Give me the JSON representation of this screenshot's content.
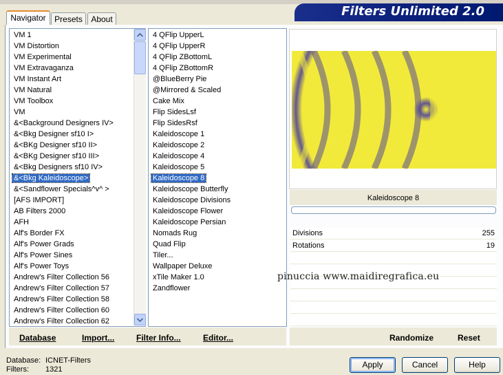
{
  "title": "Filters Unlimited 2.0",
  "tabs": [
    {
      "label": "Navigator",
      "active": true
    },
    {
      "label": "Presets",
      "active": false
    },
    {
      "label": "About",
      "active": false
    }
  ],
  "categories": [
    "VM 1",
    "VM Distortion",
    "VM Experimental",
    "VM Extravaganza",
    "VM Instant Art",
    "VM Natural",
    "VM Toolbox",
    "VM",
    "&<Background Designers IV>",
    "&<Bkg Designer sf10 I>",
    "&<BKg Designer sf10 II>",
    "&<BKg Designer sf10 III>",
    "&<Bkg Designers sf10 IV>",
    "&<Bkg Kaleidoscope>",
    "&<Sandflower Specials^v^ >",
    "[AFS IMPORT]",
    "AB Filters 2000",
    "AFH",
    "Alf's Border FX",
    "Alf's Power Grads",
    "Alf's Power Sines",
    "Alf's Power Toys",
    "Andrew's Filter Collection 56",
    "Andrew's Filter Collection 57",
    "Andrew's Filter Collection 58",
    "Andrew's Filter Collection 60",
    "Andrew's Filter Collection 62"
  ],
  "selected_category_index": 13,
  "filters": [
    "4 QFlip UpperL",
    "4 QFlip UpperR",
    "4 QFlip ZBottomL",
    "4 QFlip ZBottomR",
    "@BlueBerry Pie",
    "@Mirrored & Scaled",
    "Cake Mix",
    "Flip SidesLsf",
    "Flip SidesRsf",
    "Kaleidoscope 1",
    "Kaleidoscope 2",
    "Kaleidoscope 4",
    "Kaleidoscope 5",
    "Kaleidoscope 8",
    "Kaleidoscope Butterfly",
    "Kaleidoscope Divisions",
    "Kaleidoscope Flower",
    "Kaleidoscope Persian",
    "Nomads Rug",
    "Quad Flip",
    "Tiler...",
    "Wallpaper Deluxe",
    "xTile Maker 1.0",
    "Zandflower"
  ],
  "selected_filter_index": 13,
  "current_filter_name": "Kaleidoscope 8",
  "params": [
    {
      "label": "Divisions",
      "value": "255"
    },
    {
      "label": "Rotations",
      "value": "19"
    }
  ],
  "toolbar": {
    "database": "Database",
    "import": "Import...",
    "filter_info": "Filter Info...",
    "editor": "Editor...",
    "randomize": "Randomize",
    "reset": "Reset"
  },
  "status": {
    "database_label": "Database:",
    "database_value": "ICNET-Filters",
    "filters_label": "Filters:",
    "filters_value": "1321"
  },
  "buttons": {
    "apply": "Apply",
    "cancel": "Cancel",
    "help": "Help"
  },
  "watermark": "pinuccia www.maidiregrafica.eu",
  "colors": {
    "preview_yellow": "#f2ea3a",
    "preview_purple": "#5a4f93",
    "selection": "#316ac5",
    "title_bar": "#0a1f7a"
  }
}
